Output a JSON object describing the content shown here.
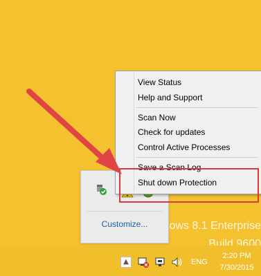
{
  "desktop": {
    "watermark_line1": "indows 8.1 Enterprise",
    "watermark_line2": "Build 9600"
  },
  "context_menu": {
    "items": [
      {
        "label": "View Status"
      },
      {
        "label": "Help and Support"
      },
      {
        "label": "Scan Now"
      },
      {
        "label": "Check for updates"
      },
      {
        "label": "Control Active Processes"
      },
      {
        "label": "Save a Scan Log"
      },
      {
        "label": "Shut down Protection"
      }
    ]
  },
  "tray_panel": {
    "customize_label": "Customize...",
    "icons": [
      "shield-check-icon",
      "warning-icon",
      "green-circle-icon"
    ]
  },
  "taskbar": {
    "show_hidden_icons": "▲",
    "icons": [
      "network-icon",
      "display-icon",
      "speaker-icon"
    ],
    "language": "ENG",
    "time": "2:20 PM",
    "date": "7/30/2015"
  },
  "colors": {
    "desktop": "#f4c12f",
    "highlight": "#d83a3a",
    "arrow": "#e04545",
    "link": "#1a5fa6"
  }
}
